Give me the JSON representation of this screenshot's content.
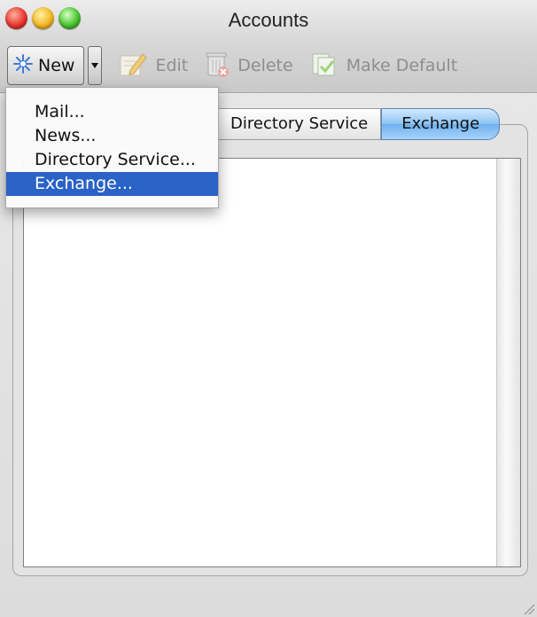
{
  "window": {
    "title": "Accounts"
  },
  "toolbar": {
    "new_label": "New",
    "edit_label": "Edit",
    "delete_label": "Delete",
    "make_default_label": "Make Default"
  },
  "tabs": [
    {
      "label": "Directory Service",
      "active": false
    },
    {
      "label": "Exchange",
      "active": true
    }
  ],
  "new_menu": {
    "items": [
      {
        "label": "Mail...",
        "selected": false
      },
      {
        "label": "News...",
        "selected": false
      },
      {
        "label": "Directory Service...",
        "selected": false
      },
      {
        "label": "Exchange...",
        "selected": true
      }
    ]
  },
  "icons": {
    "new": "sparkle-star-icon",
    "edit": "pencil-paper-icon",
    "delete": "trash-can-icon",
    "make_default": "documents-check-icon"
  },
  "colors": {
    "selection": "#2a62c6",
    "active_tab": "#8ec2f2"
  }
}
